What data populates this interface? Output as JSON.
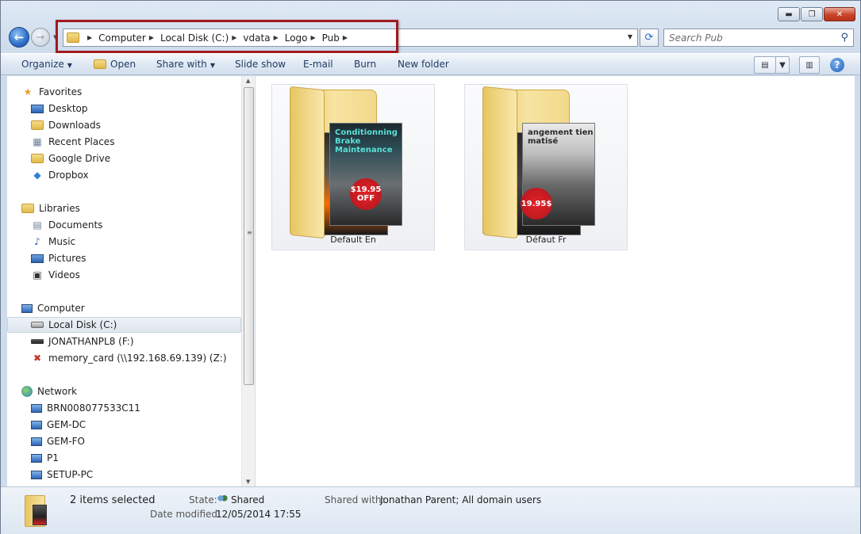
{
  "window": {
    "caption": {
      "minimize": "▬",
      "maximize": "❐",
      "close": "✕"
    }
  },
  "address": {
    "crumbs": [
      "Computer",
      "Local Disk (C:)",
      "vdata",
      "Logo",
      "Pub"
    ],
    "search_placeholder": "Search Pub"
  },
  "toolbar": {
    "organize": "Organize",
    "open": "Open",
    "share_with": "Share with",
    "slide_show": "Slide show",
    "email": "E-mail",
    "burn": "Burn",
    "new_folder": "New folder",
    "help": "?"
  },
  "nav": {
    "favorites": {
      "label": "Favorites",
      "items": [
        "Desktop",
        "Downloads",
        "Recent Places",
        "Google Drive",
        "Dropbox"
      ]
    },
    "libraries": {
      "label": "Libraries",
      "items": [
        "Documents",
        "Music",
        "Pictures",
        "Videos"
      ]
    },
    "computer": {
      "label": "Computer",
      "items": [
        "Local Disk (C:)",
        "JONATHANPL8 (F:)",
        "memory_card (\\\\192.168.69.139) (Z:)"
      ]
    },
    "network": {
      "label": "Network",
      "items": [
        "BRN008077533C11",
        "GEM-DC",
        "GEM-FO",
        "P1",
        "SETUP-PC"
      ]
    },
    "selected": "Local Disk (C:)"
  },
  "content": {
    "folders": [
      {
        "name": "Default En",
        "poster_title": "Conditionning\nBrake\nMaintenance",
        "sticker": "$19.95\nOFF"
      },
      {
        "name": "Défaut Fr",
        "poster_title": "angement\ntien\nmatisé",
        "sticker": "19.95$"
      }
    ]
  },
  "details": {
    "selection": "2 items selected",
    "state_label": "State:",
    "state_value": "Shared",
    "shared_with_label": "Shared with:",
    "shared_with_value": "Jonathan Parent; All domain users",
    "date_label": "Date modified:",
    "date_value": "12/05/2014 17:55"
  },
  "colors": {
    "highlight_box": "#a11a21",
    "toolbar_text": "#1e3a5f"
  }
}
